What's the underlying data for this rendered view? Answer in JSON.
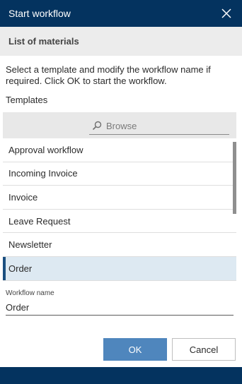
{
  "dialog": {
    "title": "Start workflow",
    "section_title": "List of materials",
    "instructions": "Select a template and modify the workflow name if required. Click OK to start the workflow.",
    "templates_label": "Templates"
  },
  "search": {
    "placeholder": "Browse",
    "icon": "search-icon"
  },
  "templates": [
    {
      "label": "Approval workflow",
      "selected": false
    },
    {
      "label": "Incoming Invoice",
      "selected": false
    },
    {
      "label": "Invoice",
      "selected": false
    },
    {
      "label": "Leave Request",
      "selected": false
    },
    {
      "label": "Newsletter",
      "selected": false
    },
    {
      "label": "Order",
      "selected": true
    }
  ],
  "workflow_name": {
    "label": "Workflow name",
    "value": "Order"
  },
  "buttons": {
    "ok": "OK",
    "cancel": "Cancel"
  },
  "colors": {
    "titlebar": "#04335f",
    "primary_button": "#4f86bd",
    "selected_row": "#dde9f2",
    "selected_marker": "#1a4f80"
  }
}
